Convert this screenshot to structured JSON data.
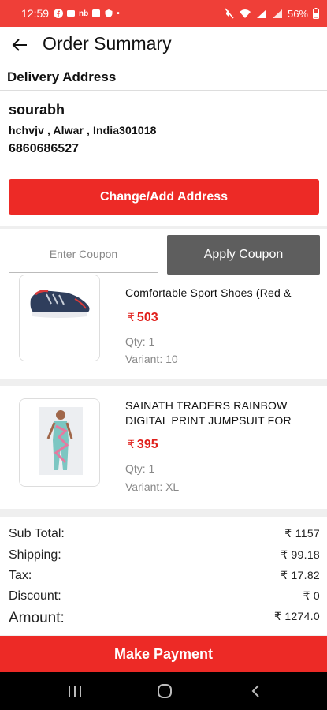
{
  "status_bar": {
    "time": "12:59",
    "notif_labels": [
      "f",
      "◘",
      "nb",
      "◘",
      "◘",
      "•"
    ],
    "battery": "56%"
  },
  "header": {
    "title": "Order Summary"
  },
  "delivery": {
    "heading": "Delivery Address",
    "name": "sourabh",
    "address_line": "hchvjv , Alwar ,  India301018",
    "phone": "6860686527",
    "change_button": "Change/Add Address"
  },
  "coupon": {
    "placeholder": "Enter Coupon",
    "apply_button": "Apply Coupon"
  },
  "products": [
    {
      "title": "Comfortable Sport Shoes (Red &",
      "currency": "₹",
      "price": "503",
      "qty": "Qty: 1",
      "variant": "Variant: 10"
    },
    {
      "title": "SAINATH TRADERS RAINBOW DIGITAL PRINT JUMPSUIT FOR",
      "currency": "₹",
      "price": "395",
      "qty": "Qty: 1",
      "variant": "Variant: XL"
    }
  ],
  "summary": {
    "sub_total_label": "Sub Total:",
    "sub_total": "₹ 1157",
    "shipping_label": "Shipping:",
    "shipping": "₹ 99.18",
    "tax_label": "Tax:",
    "tax": "₹ 17.82",
    "discount_label": "Discount:",
    "discount": "₹ 0",
    "amount_label": "Amount:",
    "amount": "₹ 1274.0"
  },
  "pay_button": "Make Payment",
  "colors": {
    "brand_red": "#ed2a26",
    "status_red": "#ef3f38",
    "apply_gray": "#5e5e5e",
    "price_red": "#e0201c"
  }
}
